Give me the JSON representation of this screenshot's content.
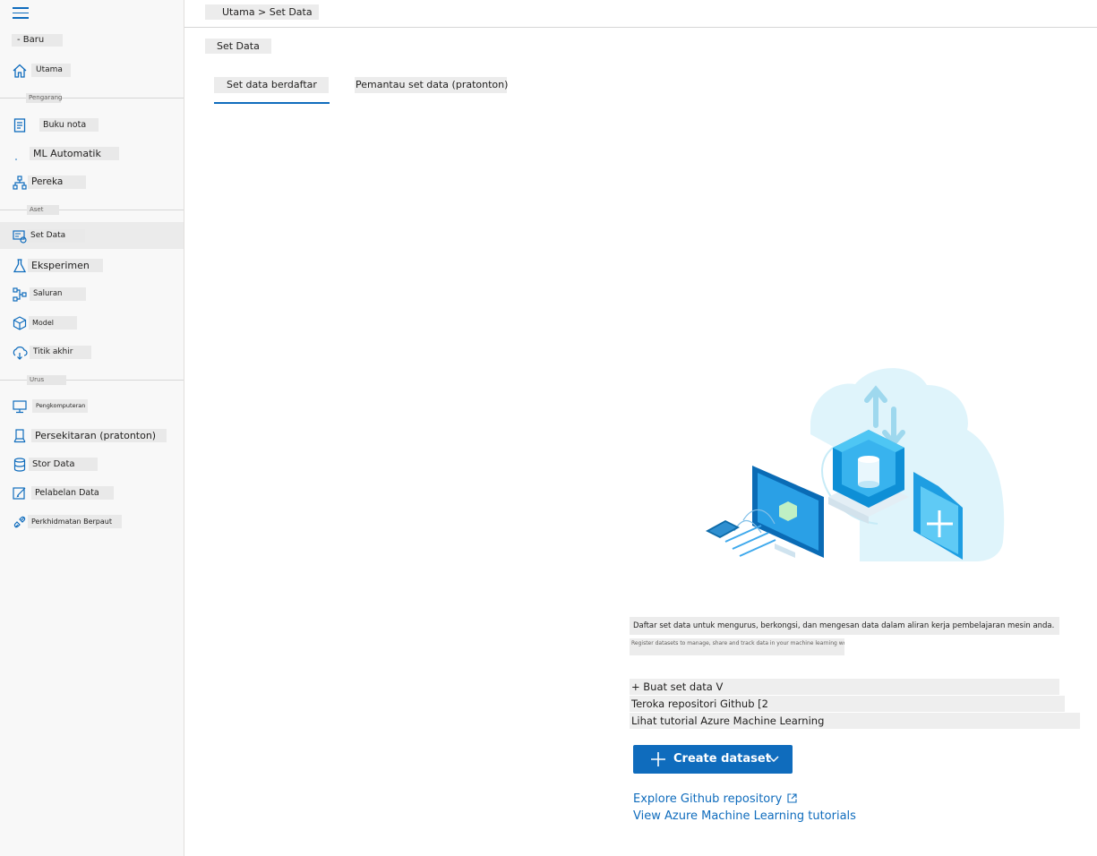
{
  "sidebar": {
    "new_label": "- Baru",
    "home": "Utama",
    "section_author": "Pengarang",
    "notebooks": "Buku nota",
    "automl": "ML Automatik",
    "designer": "Pereka",
    "section_assets": "Aset",
    "datasets": "Set Data",
    "experiments": "Eksperimen",
    "pipelines": "Saluran",
    "models": "Model",
    "endpoints": "Titik akhir",
    "section_manage": "Urus",
    "compute": "Pengkomputeran",
    "environments": "Persekitaran (pratonton)",
    "datastores": "Stor Data",
    "data_labeling": "Pelabelan Data",
    "linked_services": "Perkhidmatan Berpaut"
  },
  "header": {
    "breadcrumb": "Utama > Set Data",
    "page_title": "Set Data"
  },
  "tabs": [
    {
      "label": "Set data berdaftar"
    },
    {
      "label": "Pemantau set data (pratonton)"
    }
  ],
  "empty_state": {
    "description": "Daftar set data untuk mengurus, berkongsi, dan mengesan data dalam aliran kerja pembelajaran mesin anda.",
    "sub_description": "Register datasets to manage, share and track data in your machine learning workflows.",
    "options": [
      "+ Buat set data V",
      "Teroka repositori Github [2",
      "Lihat tutorial Azure Machine Learning"
    ],
    "create_button": "Create dataset",
    "link_github": "Explore Github repository",
    "link_tutorials": "View Azure Machine Learning tutorials"
  },
  "colors": {
    "accent": "#0f6cbd",
    "sidebar_bg": "#f8f8f8",
    "active_item_bg": "#ebebeb"
  }
}
